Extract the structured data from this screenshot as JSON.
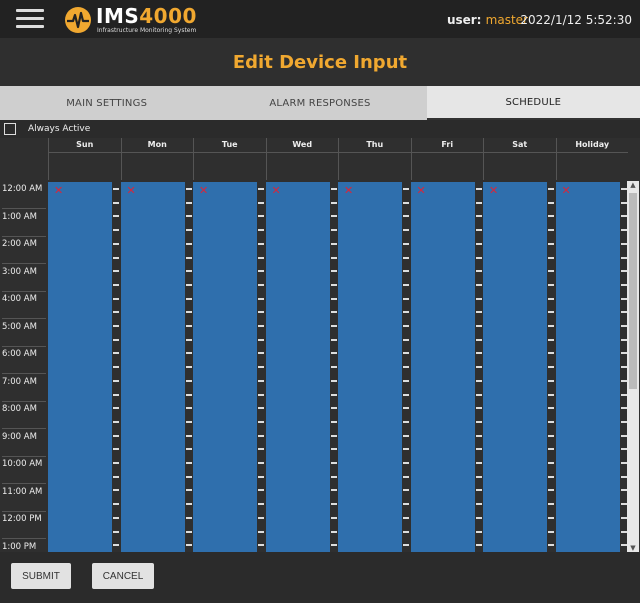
{
  "header": {
    "brand_ims": "IMS",
    "brand_num": "4000",
    "tagline": "Infrastructure Monitoring System",
    "user_label": "user:",
    "user_name": "master",
    "datetime": "2022/1/12 5:52:30"
  },
  "page": {
    "title": "Edit Device Input"
  },
  "tabs": [
    {
      "label": "MAIN SETTINGS",
      "active": false
    },
    {
      "label": "ALARM RESPONSES",
      "active": false
    },
    {
      "label": "SCHEDULE",
      "active": true
    }
  ],
  "always_active": {
    "label": "Always Active",
    "checked": false
  },
  "days": [
    "Sun",
    "Mon",
    "Tue",
    "Wed",
    "Thu",
    "Fri",
    "Sat",
    "Holiday"
  ],
  "times": [
    "12:00 AM",
    "1:00 AM",
    "2:00 AM",
    "3:00 AM",
    "4:00 AM",
    "5:00 AM",
    "6:00 AM",
    "7:00 AM",
    "8:00 AM",
    "9:00 AM",
    "10:00 AM",
    "11:00 AM",
    "12:00 PM",
    "1:00 PM"
  ],
  "delete_mark": "✕",
  "actions": {
    "submit": "SUBMIT",
    "cancel": "CANCEL"
  },
  "colors": {
    "accent": "#f0a830",
    "slot": "#2f6fad",
    "delete": "#d9263a"
  }
}
